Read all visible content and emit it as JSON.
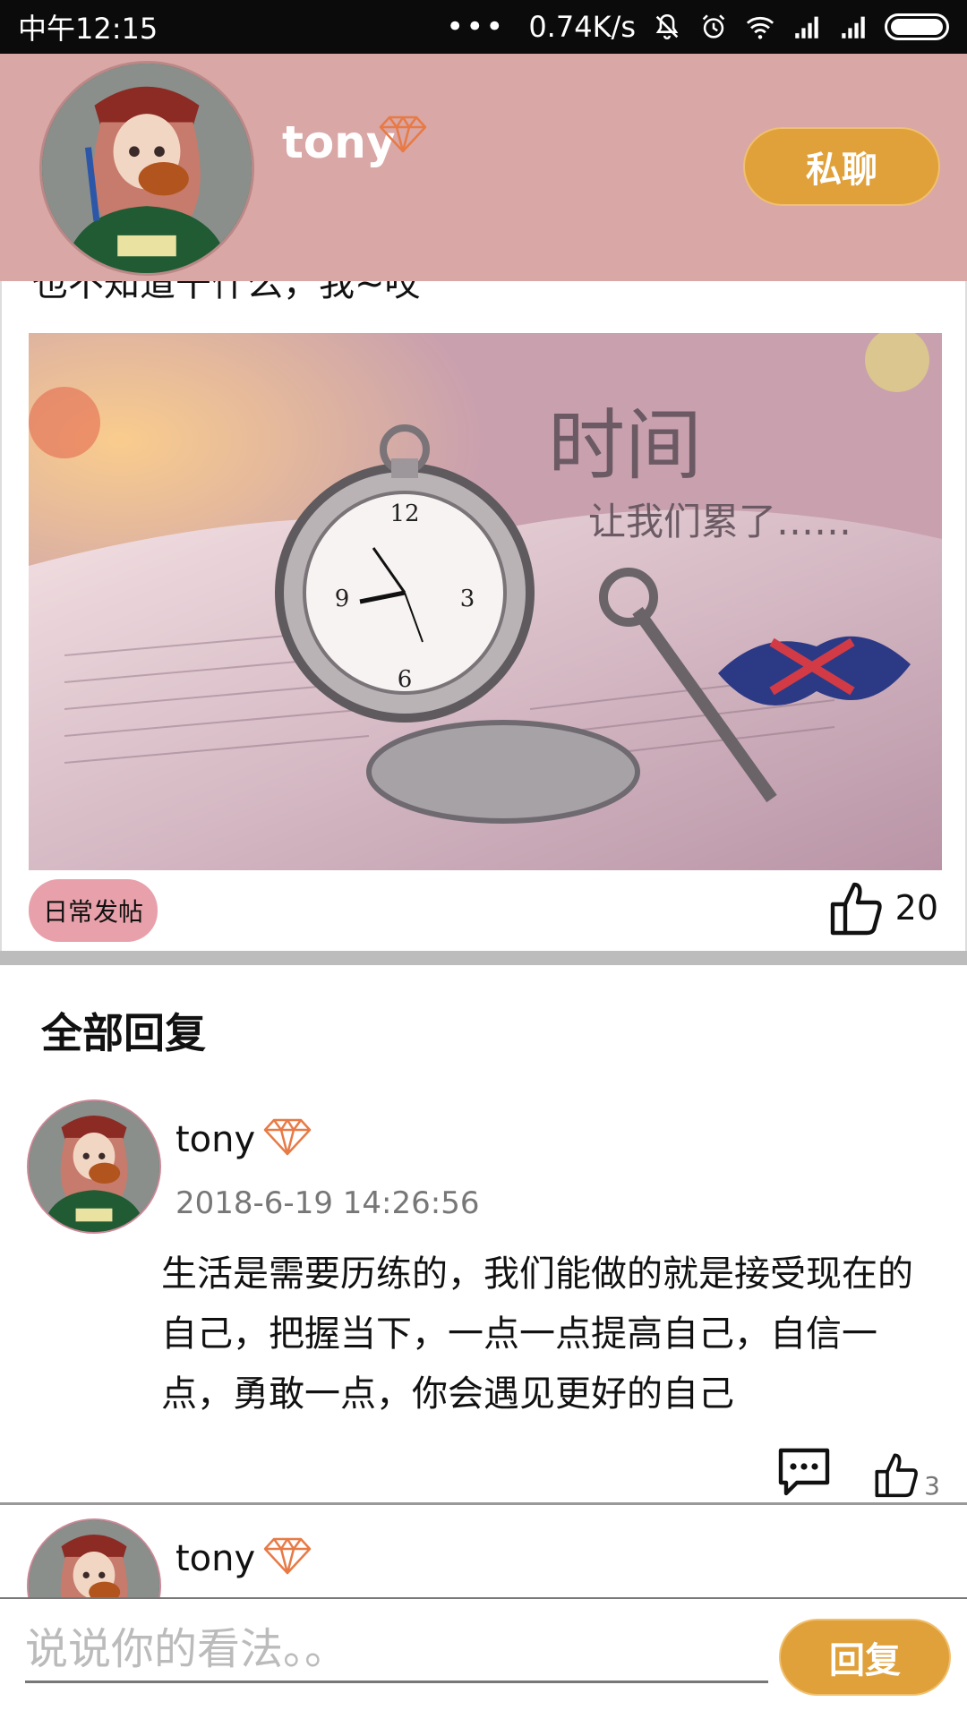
{
  "status_bar": {
    "time": "中午12:15",
    "dots": "•••",
    "network_speed": "0.74K/s"
  },
  "profile": {
    "name": "tony",
    "chat_button_label": "私聊"
  },
  "post": {
    "text": "也不知道干什么，我~哎",
    "image_title": "时间",
    "image_caption": "让我们累了……",
    "tag": "日常发帖",
    "like_count": "20"
  },
  "replies": {
    "heading": "全部回复",
    "items": [
      {
        "name": "tony",
        "time": "2018-6-19 14:26:56",
        "content": "生活是需要历练的，我们能做的就是接受现在的自己，把握当下，一点一点提高自己，自信一点，勇敢一点，你会遇见更好的自己",
        "like_count": "3"
      },
      {
        "name": "tony"
      }
    ]
  },
  "input_bar": {
    "placeholder": "说说你的看法。。",
    "reply_button_label": "回复"
  },
  "colors": {
    "header_bg": "#d9a7a6",
    "accent": "#e0a03a",
    "tag_bg": "#e8a1aa",
    "diamond": "#e87a45"
  }
}
